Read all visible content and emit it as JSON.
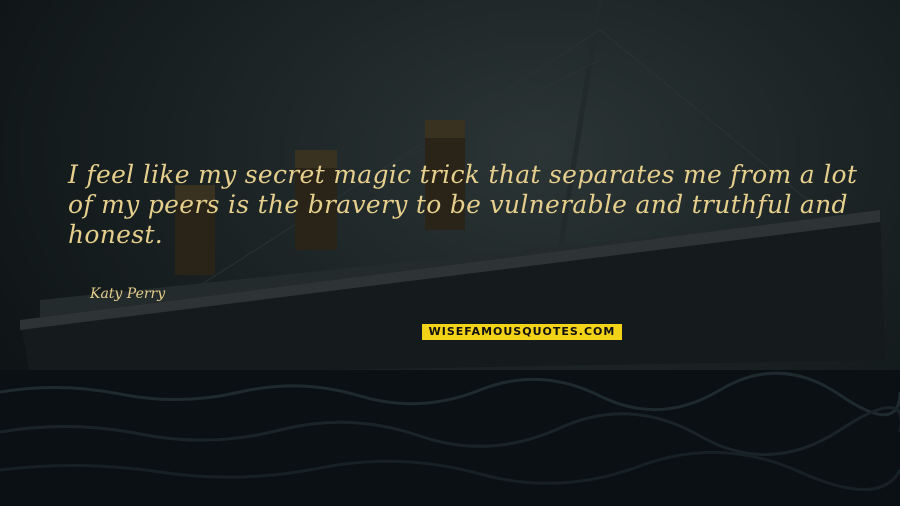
{
  "quote": {
    "text": "I feel like my secret magic trick that separates me from a lot of my peers is the bravery to be vulnerable and truthful and honest.",
    "author": "Katy Perry"
  },
  "watermark": {
    "text": "WISEFAMOUSQUOTES.COM",
    "background": "#f2d318"
  },
  "colors": {
    "quote_text": "#e6cf8c",
    "sky": "#1a2224",
    "sea": "#0b1014"
  }
}
